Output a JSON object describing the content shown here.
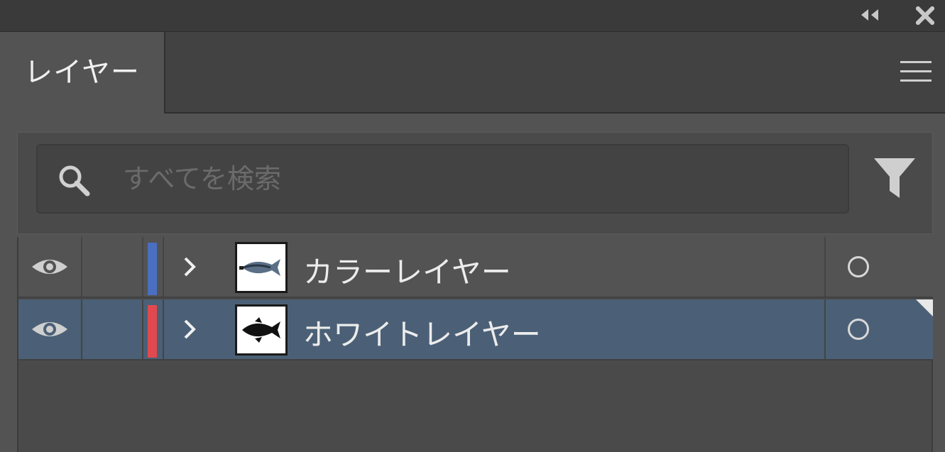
{
  "panel": {
    "tab_label": "レイヤー",
    "collapse_icon": "double-chevron-left-icon",
    "close_icon": "close-icon",
    "menu_icon": "hamburger-menu-icon"
  },
  "search": {
    "placeholder": "すべてを検索",
    "value": "",
    "icon": "search-icon",
    "filter_icon": "filter-icon"
  },
  "layers": [
    {
      "name": "カラーレイヤー",
      "visible": true,
      "locked": false,
      "color": "#4a6fc1",
      "selected": false,
      "thumbnail": "color-fish-thumbnail"
    },
    {
      "name": "ホワイトレイヤー",
      "visible": true,
      "locked": false,
      "color": "#e0494f",
      "selected": true,
      "thumbnail": "black-fish-thumbnail"
    }
  ],
  "colors": {
    "selected_row": "#4b6076",
    "panel_bg": "#535353"
  }
}
